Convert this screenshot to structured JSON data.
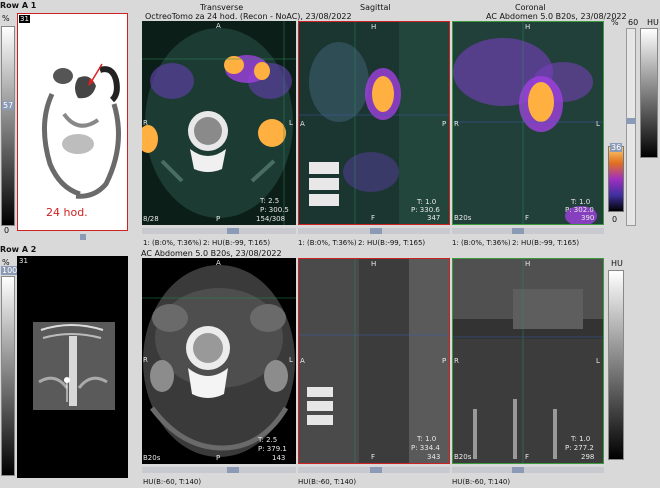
{
  "row1": {
    "title": "Row A 1",
    "num": "31",
    "scale_top": "%",
    "scale_mid": "57",
    "scale_bot": "0",
    "mip_caption": "24 hod.",
    "header_left": "OctreoTomo za 24 hod. (Recon - NoAC), 23/08/2022",
    "header_right": "AC Abdomen 5.0 B20s, 23/08/2022",
    "view_titles": [
      "Transverse",
      "Sagittal",
      "Coronal"
    ],
    "right_scale": {
      "pct": "%",
      "v60": "60",
      "hu": "HU",
      "v36": "36",
      "v0": "0"
    },
    "views": [
      {
        "t": "T: 2.5",
        "p": "P: 300.5",
        "slice": "154/308",
        "left_lbl": "A",
        "top_lbl": "A",
        "l": "R",
        "r": "L",
        "b": "P",
        "corner": "8/28"
      },
      {
        "t": "T: 1.0",
        "p": "P: 330.6",
        "slice": "347",
        "top_lbl": "H",
        "l": "A",
        "r": "P",
        "b": "F",
        "corner": ""
      },
      {
        "t": "T: 1.0",
        "p": "P: 302.0",
        "slice": "390",
        "top_lbl": "H",
        "l": "R",
        "r": "L",
        "b": "F",
        "corner": "B20s"
      }
    ],
    "context": [
      "1: (B:0%, T:36%)",
      "2: HU(B:-99, T:165)",
      "1: (B:0%, T:36%)",
      "2: HU(B:-99, T:165)",
      "1: (B:0%, T:36%)",
      "2: HU(B:-99, T:165)"
    ]
  },
  "row2": {
    "title": "Row A 2",
    "num": "31",
    "scale_top": "%",
    "scale_mid": "100",
    "header_left": "AC Abdomen 5.0 B20s, 23/08/2022",
    "right_scale": {
      "hu": "HU"
    },
    "views": [
      {
        "t": "T: 2.5",
        "p": "P: 379.1",
        "slice": "143",
        "top_lbl": "A",
        "l": "R",
        "r": "L",
        "b": "P",
        "corner": "B20s"
      },
      {
        "t": "T: 1.0",
        "p": "P: 334.4",
        "slice": "343",
        "top_lbl": "H",
        "l": "A",
        "r": "P",
        "b": "F",
        "corner": ""
      },
      {
        "t": "T: 1.0",
        "p": "P: 277.2",
        "slice": "298",
        "top_lbl": "H",
        "l": "R",
        "r": "L",
        "b": "F",
        "corner": "B20s"
      }
    ],
    "context": [
      "HU(B:-60, T:140)",
      "HU(B:-60, T:140)",
      "HU(B:-60, T:140)"
    ]
  },
  "colors": {
    "pet_hot": "#ffb040",
    "pet_mid": "#a040e0",
    "frame_red": "#cc2222",
    "frame_green": "#3c9a3c",
    "ct_bone": "#f0f0f0"
  }
}
